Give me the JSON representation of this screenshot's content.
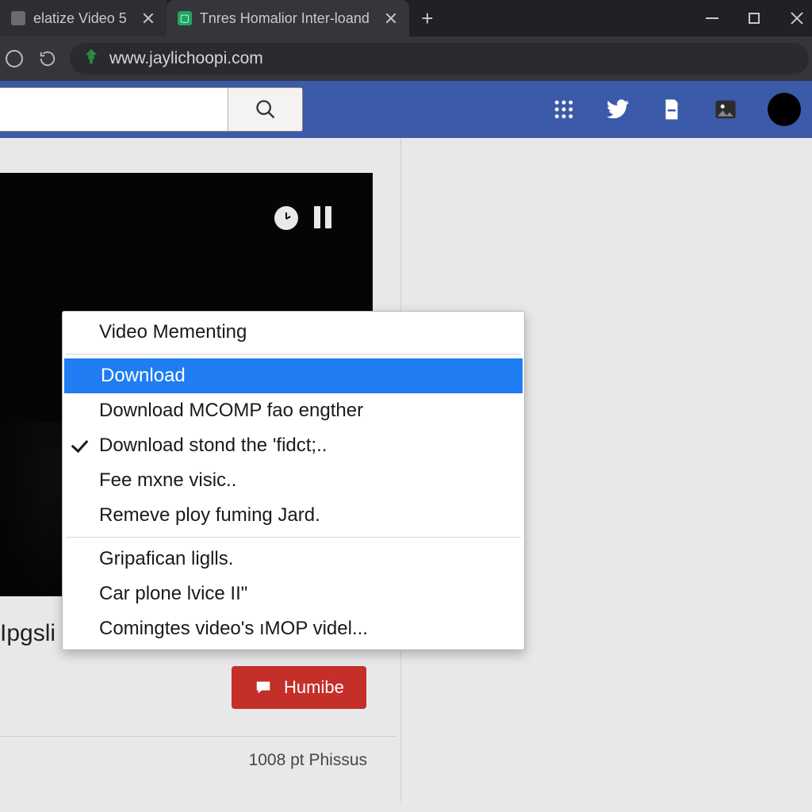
{
  "browser": {
    "tabs": [
      {
        "title": "elatize Video 5",
        "favicon_bg": "#6b6b6b"
      },
      {
        "title": "Tnres Homalior Inter-loand",
        "favicon_bg": "#1fa463"
      }
    ],
    "url": "www.jaylichoopi.com"
  },
  "topbar": {
    "search_placeholder": ""
  },
  "video": {
    "below_title": "Ipgsli",
    "action_button": "Humibe",
    "meta": "1008 pt Phissus"
  },
  "context_menu": {
    "header": "Video Mementing",
    "group1": [
      "Download",
      "Download MCOMP fao engther",
      "Download stond the 'fidct;..",
      "Fee mxne visic..",
      "Remeve ploy fuming Jard."
    ],
    "group2": [
      "Gripafican liglls.",
      "Car plone lvice II\"",
      "Comingtes video's ıMOP videl..."
    ],
    "highlighted_index": 0,
    "checked_index": 2
  }
}
